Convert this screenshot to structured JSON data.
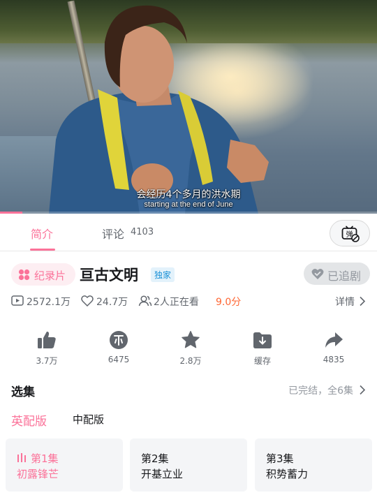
{
  "player": {
    "subtitle_cn": "会经历4个多月的洪水期",
    "subtitle_en": "starting at the end of June",
    "progress_fraction": 0.06
  },
  "tabs": {
    "intro_label": "简介",
    "comment_label": "评论",
    "comment_count": "4103"
  },
  "info": {
    "category": "纪录片",
    "title": "亘古文明",
    "exclusive_badge": "独家",
    "follow_label": "已追剧",
    "plays": "2572.1万",
    "likes": "24.7万",
    "watching": "2人正在看",
    "score": "9.0分",
    "details_label": "详情"
  },
  "actions": [
    {
      "icon": "thumb-up-icon",
      "label": "3.7万"
    },
    {
      "icon": "coin-icon",
      "label": "6475"
    },
    {
      "icon": "star-icon",
      "label": "2.8万"
    },
    {
      "icon": "download-folder-icon",
      "label": "缓存"
    },
    {
      "icon": "share-icon",
      "label": "4835"
    }
  ],
  "episodes": {
    "heading": "选集",
    "status": "已完结，全6集",
    "versions": [
      "英配版",
      "中配版"
    ],
    "items": [
      {
        "number": "第1集",
        "name": "初露锋芒"
      },
      {
        "number": "第2集",
        "name": "开基立业"
      },
      {
        "number": "第3集",
        "name": "积势蓄力"
      }
    ]
  },
  "colors": {
    "accent": "#fb7299",
    "score": "#ff6633",
    "exclusive": "#1890d6",
    "muted": "#9499a0"
  }
}
